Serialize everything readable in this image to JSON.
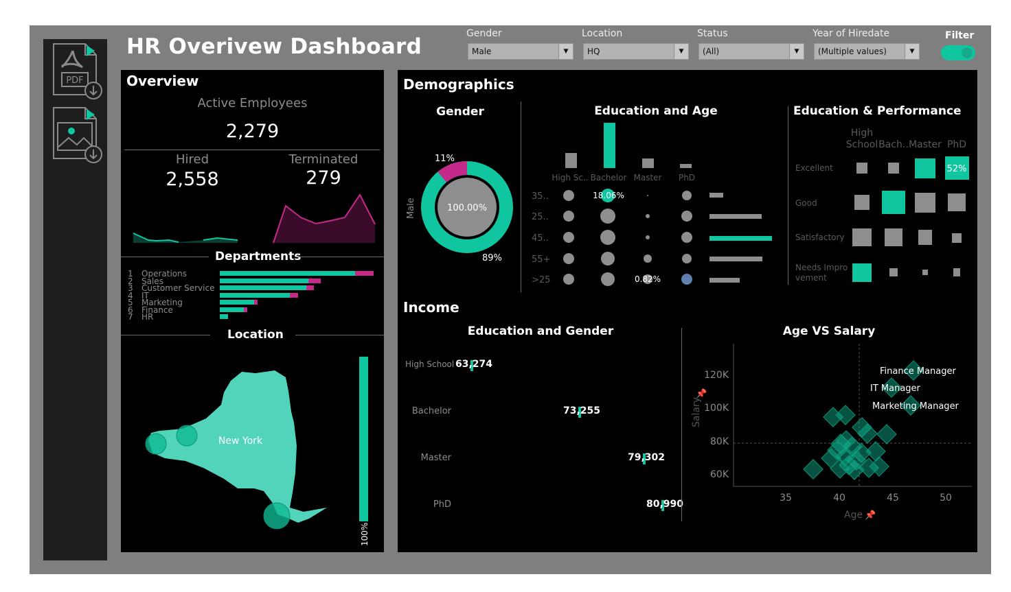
{
  "title": "HR Overivew Dashboard",
  "toolbar": {
    "pdf_icon": "pdf-download-icon",
    "image_icon": "image-download-icon"
  },
  "filters": {
    "gender": {
      "label": "Gender",
      "value": "Male"
    },
    "location": {
      "label": "Location",
      "value": "HQ"
    },
    "status": {
      "label": "Status",
      "value": "(All)"
    },
    "year": {
      "label": "Year of Hiredate",
      "value": "(Multiple values)"
    },
    "toggle_label": "Filter",
    "toggle_on": true
  },
  "colors": {
    "accent": "#0fc6a0",
    "magenta": "#c42a8a",
    "panel": "#000000",
    "frame": "#7f7f7f"
  },
  "overview": {
    "heading": "Overview",
    "active_label": "Active Employees",
    "active_value": "2,279",
    "hired_label": "Hired",
    "hired_value": "2,558",
    "terminated_label": "Terminated",
    "terminated_value": "279"
  },
  "departments": {
    "heading": "Departments",
    "items": [
      {
        "rank": "1",
        "name": "Operations",
        "hired": 198,
        "terminated": 27
      },
      {
        "rank": "2",
        "name": "Sales",
        "hired": 130,
        "terminated": 18
      },
      {
        "rank": "3",
        "name": "Customer Service",
        "hired": 127,
        "terminated": 11
      },
      {
        "rank": "4",
        "name": "IT",
        "hired": 102,
        "terminated": 13
      },
      {
        "rank": "5",
        "name": "Marketing",
        "hired": 50,
        "terminated": 5
      },
      {
        "rank": "6",
        "name": "Finance",
        "hired": 35,
        "terminated": 5
      },
      {
        "rank": "7",
        "name": "HR",
        "hired": 12,
        "terminated": 0
      }
    ]
  },
  "location": {
    "heading": "Location",
    "state_label": "New York",
    "bar_label": "100%",
    "bar_fraction": 1.0
  },
  "demographics": {
    "heading": "Demographics",
    "gender": {
      "heading": "Gender",
      "axis_label": "Male",
      "center_label": "100.00%",
      "pct_major": "89%",
      "pct_minor": "11%"
    },
    "edu_age": {
      "heading": "Education and Age",
      "columns": [
        "High Sc..",
        "Bachelor",
        "Master",
        "PhD"
      ],
      "rows": [
        "35..",
        "25..",
        "45..",
        "55+",
        ">25"
      ],
      "label_highlight": "18.06%",
      "label_small": "0.82%"
    },
    "edu_perf": {
      "heading": "Education & Performance",
      "columns": [
        "High School",
        "Bach..",
        "Master",
        "PhD"
      ],
      "rows": [
        "Excellent",
        "Good",
        "Satisfactory",
        "Needs Improvement"
      ],
      "highlight_label": "52%"
    }
  },
  "income": {
    "heading": "Income",
    "edu_gender": {
      "heading": "Education and Gender",
      "rows": [
        {
          "label": "High School",
          "value": "63,274"
        },
        {
          "label": "Bachelor",
          "value": "73,255"
        },
        {
          "label": "Master",
          "value": "79,302"
        },
        {
          "label": "PhD",
          "value": "80,990"
        }
      ]
    },
    "age_salary": {
      "heading": "Age VS Salary",
      "xlabel": "Age",
      "ylabel": "Salary",
      "x_ticks": [
        "35",
        "40",
        "45",
        "50"
      ],
      "y_ticks": [
        "120K",
        "100K",
        "80K",
        "60K"
      ],
      "annotations": [
        "Finance Manager",
        "IT Manager",
        "Marketing Manager"
      ]
    }
  }
}
